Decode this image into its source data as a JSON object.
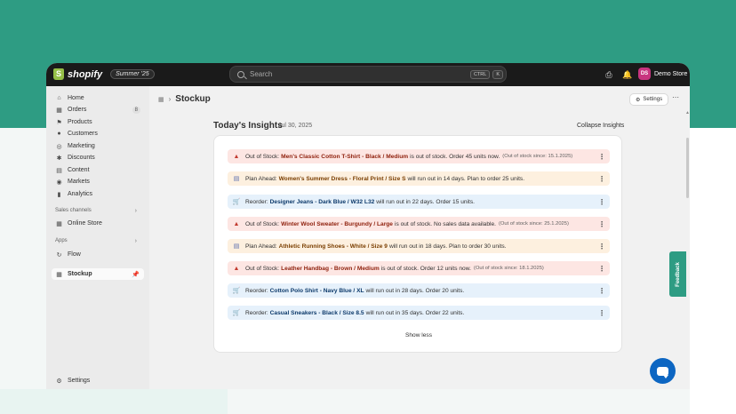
{
  "topbar": {
    "logo": "shopify",
    "edition": "Summer '25",
    "search_placeholder": "Search",
    "shortcut_ctrl": "CTRL",
    "shortcut_key": "K",
    "store_initials": "DS",
    "store_name": "Demo Store",
    "icons": [
      "printer-icon",
      "bell-icon"
    ]
  },
  "sidebar": {
    "items": [
      {
        "label": "Home",
        "icon": "home-icon"
      },
      {
        "label": "Orders",
        "icon": "orders-icon",
        "badge": "8"
      },
      {
        "label": "Products",
        "icon": "tag-icon"
      },
      {
        "label": "Customers",
        "icon": "person-icon"
      },
      {
        "label": "Marketing",
        "icon": "target-icon"
      },
      {
        "label": "Discounts",
        "icon": "discount-icon"
      },
      {
        "label": "Content",
        "icon": "content-icon"
      },
      {
        "label": "Markets",
        "icon": "globe-icon"
      },
      {
        "label": "Analytics",
        "icon": "chart-icon"
      }
    ],
    "sales_channels_label": "Sales channels",
    "online_store": "Online Store",
    "apps_label": "Apps",
    "flow": "Flow",
    "stockup": "Stockup",
    "settings": "Settings"
  },
  "main": {
    "page_title": "Stockup",
    "settings_label": "Settings",
    "insights_title": "Today's Insights",
    "insights_date": "Jul 30, 2025",
    "collapse_label": "Collapse Insights",
    "show_less": "Show less",
    "insights": [
      {
        "type": "out",
        "prefix": "Out of Stock:",
        "product": "Men's Classic Cotton T-Shirt - Black / Medium",
        "message": "is out of stock. Order 45 units now.",
        "since": "(Out of stock since: 15.1.2025)"
      },
      {
        "type": "plan",
        "prefix": "Plan Ahead:",
        "product": "Women's Summer Dress - Floral Print / Size S",
        "message": "will run out in 14 days. Plan to order 25 units.",
        "since": ""
      },
      {
        "type": "reorder",
        "prefix": "Reorder:",
        "product": "Designer Jeans - Dark Blue / W32 L32",
        "message": "will run out in 22 days. Order 15 units.",
        "since": ""
      },
      {
        "type": "out",
        "prefix": "Out of Stock:",
        "product": "Winter Wool Sweater - Burgundy / Large",
        "message": "is out of stock. No sales data available.",
        "since": "(Out of stock since: 25.1.2025)"
      },
      {
        "type": "plan",
        "prefix": "Plan Ahead:",
        "product": "Athletic Running Shoes - White / Size 9",
        "message": "will run out in 18 days. Plan to order 30 units.",
        "since": ""
      },
      {
        "type": "out",
        "prefix": "Out of Stock:",
        "product": "Leather Handbag - Brown / Medium",
        "message": "is out of stock. Order 12 units now.",
        "since": "(Out of stock since: 18.1.2025)"
      },
      {
        "type": "reorder",
        "prefix": "Reorder:",
        "product": "Cotton Polo Shirt - Navy Blue / XL",
        "message": "will run out in 28 days. Order 20 units.",
        "since": ""
      },
      {
        "type": "reorder",
        "prefix": "Reorder:",
        "product": "Casual Sneakers - Black / Size 8.5",
        "message": "will run out in 35 days. Order 22 units.",
        "since": ""
      }
    ]
  },
  "feedback_label": "Feedback",
  "colors": {
    "brand_green": "#2e9c83",
    "out_bg": "#fde6e3",
    "plan_bg": "#fdf0df",
    "reorder_bg": "#e6f1fb",
    "chat_blue": "#0d66c2"
  }
}
